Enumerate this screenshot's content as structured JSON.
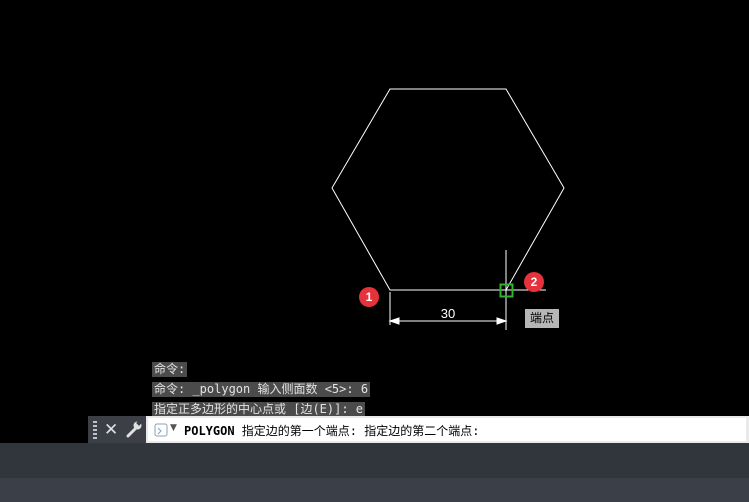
{
  "drawing": {
    "dimension_value": "30",
    "marker_1": "1",
    "marker_2": "2",
    "snap_tooltip": "端点"
  },
  "history": [
    "命令:",
    "命令: _polygon 输入侧面数 <5>: 6",
    "指定正多边形的中心点或 [边(E)]: e"
  ],
  "command_line": {
    "command": "POLYGON",
    "prompt": " 指定边的第一个端点: 指定边的第二个端点:"
  },
  "colors": {
    "background": "#000000",
    "geometry": "#ffffff",
    "marker": "#e5323b",
    "snap_marker": "#2fb52f"
  },
  "icons": [
    "close-icon",
    "wrench-icon",
    "command-prompt-icon",
    "chevron-down-icon",
    "snap-endpoint-icon"
  ]
}
